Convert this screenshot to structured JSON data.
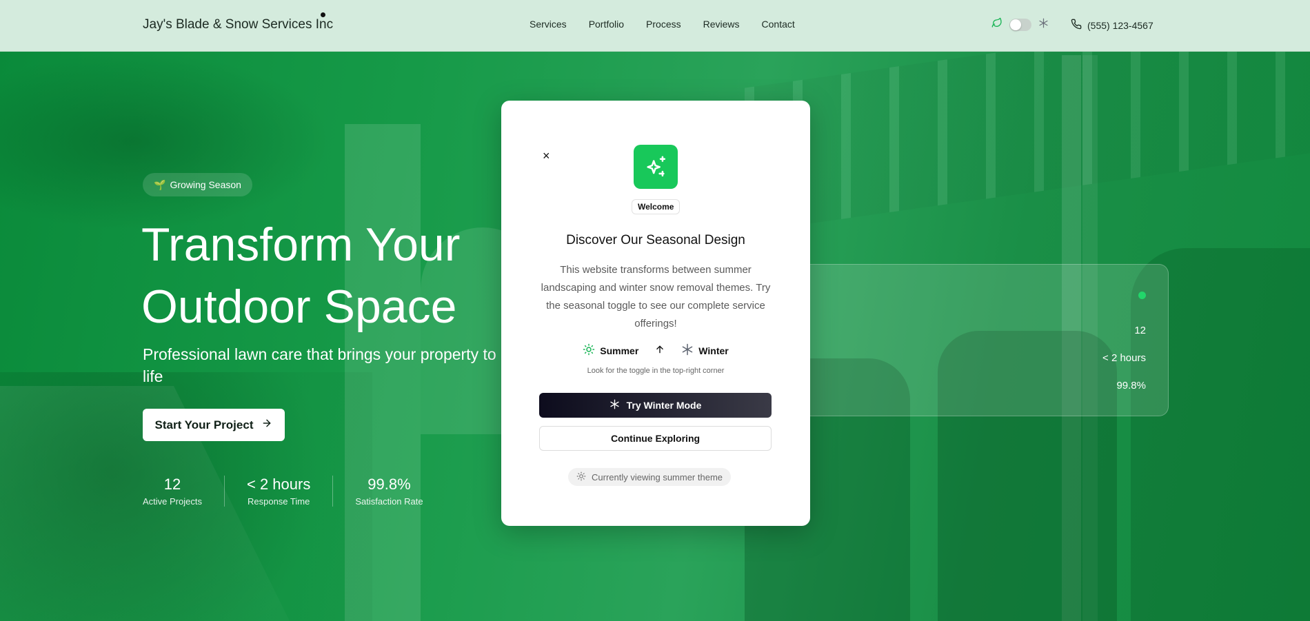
{
  "header": {
    "brand": "Jay's Blade & Snow Services Inc",
    "nav": [
      "Services",
      "Portfolio",
      "Process",
      "Reviews",
      "Contact"
    ],
    "phone": "(555) 123-4567",
    "season_toggle_on": false
  },
  "hero": {
    "badge": "Growing Season",
    "headline_line1": "Transform Your",
    "headline_line2": "Outdoor Space",
    "subhead": "Professional lawn care that brings your property to life",
    "cta": "Start Your Project",
    "stats": [
      {
        "value": "12",
        "label": "Active Projects"
      },
      {
        "value": "< 2 hours",
        "label": "Response Time"
      },
      {
        "value": "99.8%",
        "label": "Satisfaction Rate"
      }
    ]
  },
  "glass_panel": {
    "values": [
      "12",
      "< 2 hours",
      "99.8%"
    ]
  },
  "modal": {
    "close": "×",
    "badge": "Welcome",
    "title": "Discover Our Seasonal Design",
    "description": "This website transforms between summer landscaping and winter snow removal themes. Try the seasonal toggle to see our complete service offerings!",
    "summer_label": "Summer",
    "winter_label": "Winter",
    "hint": "Look for the toggle in the top-right corner",
    "try_button": "Try Winter Mode",
    "continue_button": "Continue Exploring",
    "current_theme": "Currently viewing summer theme"
  },
  "colors": {
    "accent_green": "#18c85a",
    "header_bg": "#d4ebdd",
    "hero_green": "#169a48",
    "dark_button": "#0d0c1d"
  }
}
